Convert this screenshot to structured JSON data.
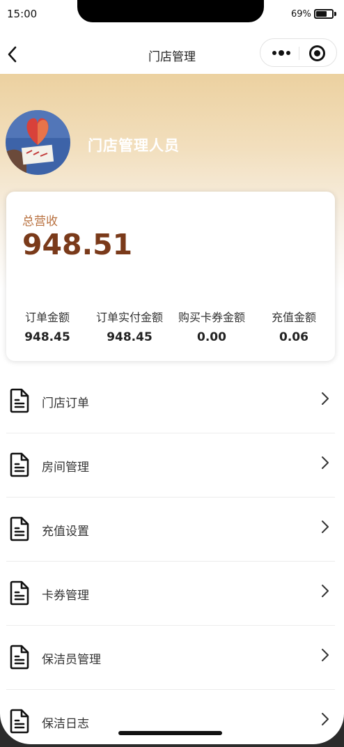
{
  "status_bar": {
    "time": "15:00",
    "battery_percent_text": "69%",
    "battery_level": 0.69
  },
  "nav": {
    "title": "门店管理",
    "icons": {
      "back": "chevron-left-icon",
      "more": "more-dots-icon",
      "close": "target-circle-icon"
    }
  },
  "profile": {
    "name": "门店管理人员",
    "avatar": "avatar-image"
  },
  "stats": {
    "total_label": "总营收",
    "total_value": "948.51",
    "items": [
      {
        "label": "订单金额",
        "value": "948.45"
      },
      {
        "label": "订单实付金额",
        "value": "948.45"
      },
      {
        "label": "购买卡券金额",
        "value": "0.00"
      },
      {
        "label": "充值金额",
        "value": "0.06"
      }
    ]
  },
  "menu": {
    "item_icon": "document-icon",
    "chevron_icon": "chevron-right-icon",
    "items": [
      {
        "label": "门店订单"
      },
      {
        "label": "房间管理"
      },
      {
        "label": "充值设置"
      },
      {
        "label": "卡券管理"
      },
      {
        "label": "保洁员管理"
      },
      {
        "label": "保洁日志"
      }
    ]
  },
  "colors": {
    "accent_label": "#b8703f",
    "accent_value": "#7a3a1a",
    "hero_gradient_top": "#ecd1a0"
  }
}
